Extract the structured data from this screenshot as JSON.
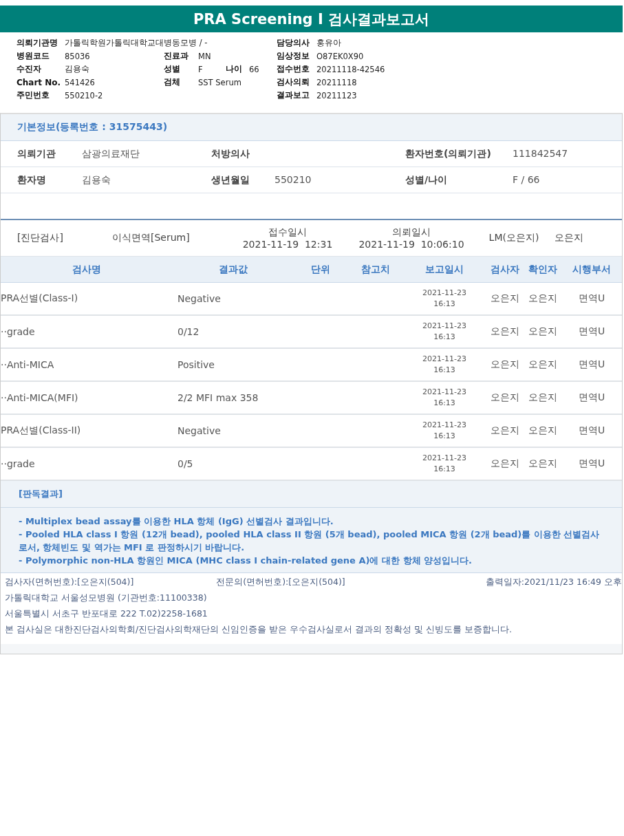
{
  "title": "PRA Screening I 검사결과보고서",
  "header_info": [
    {
      "left": {
        "label": "의뢰기관명",
        "value": "가톨릭학원가톨릭대학교대병동모병 / -"
      },
      "right": {
        "label": "담당의사",
        "value": "홍유아"
      }
    },
    {
      "left": {
        "label": "병원코드",
        "value": "85036"
      },
      "middle": [
        {
          "label": "진료과",
          "value": "MN"
        }
      ],
      "right": {
        "label": "임상정보",
        "value": "O87EK0X90"
      }
    },
    {
      "left": {
        "label": "수진자",
        "value": "김용숙"
      },
      "middle": [
        {
          "label": "성별",
          "value": "F"
        },
        {
          "label": "나이",
          "value": "66"
        }
      ],
      "right": {
        "label": "접수번호",
        "value": "20211118-42546"
      }
    },
    {
      "left": {
        "label": "Chart No.",
        "value": "541426"
      },
      "middle": [
        {
          "label": "검체",
          "value": "SST Serum"
        }
      ],
      "right": {
        "label": "검사의뢰",
        "value": "20211118"
      }
    },
    {
      "left": {
        "label": "주민번호",
        "value": "550210-2"
      },
      "right": {
        "label": "결과보고",
        "value": "20211123"
      }
    }
  ],
  "basic_info": {
    "title": "기본정보(등록번호 : 31575443)",
    "rows": [
      [
        {
          "label": "의뢰기관",
          "value": "삼광의료재단"
        },
        {
          "label": "처방의사"
        },
        {
          "label": "환자번호(의뢰기관)",
          "value": "111842547"
        }
      ],
      [
        {
          "label": "환자명",
          "value": "김용숙"
        },
        {
          "label": "생년월일",
          "value": "550210"
        },
        {
          "label": "성별/나이",
          "value": "F / 66"
        }
      ]
    ]
  },
  "exam": {
    "category": "[진단검사]",
    "specimen": "이식면역[Serum]",
    "received_label": "접수일시",
    "received": "2021-11-19  12:31",
    "requested_label": "의뢰일시",
    "requested": "2021-11-19  10:06:10",
    "lm": "LM(오은지)",
    "examiner": "오은지"
  },
  "table": {
    "columns": [
      "검사명",
      "결과값",
      "단위",
      "참고치",
      "보고일시",
      "검사자",
      "확인자",
      "시행부서"
    ],
    "rows": [
      {
        "name": "PRA선별(Class-I)",
        "result": "Negative",
        "date": "2021-11-23",
        "time": "16:13",
        "tester": "오은지",
        "confirmer": "오은지",
        "dept": "면역U"
      },
      {
        "name": "··grade",
        "result": "0/12",
        "date": "2021-11-23",
        "time": "16:13",
        "tester": "오은지",
        "confirmer": "오은지",
        "dept": "면역U"
      },
      {
        "name": "··Anti-MICA",
        "result": "Positive",
        "date": "2021-11-23",
        "time": "16:13",
        "tester": "오은지",
        "confirmer": "오은지",
        "dept": "면역U"
      },
      {
        "name": "··Anti-MICA(MFI)",
        "result": "2/2 MFI max 358",
        "date": "2021-11-23",
        "time": "16:13",
        "tester": "오은지",
        "confirmer": "오은지",
        "dept": "면역U"
      },
      {
        "name": "PRA선별(Class-II)",
        "result": "Negative",
        "date": "2021-11-23",
        "time": "16:13",
        "tester": "오은지",
        "confirmer": "오은지",
        "dept": "면역U"
      },
      {
        "name": "··grade",
        "result": "0/5",
        "date": "2021-11-23",
        "time": "16:13",
        "tester": "오은지",
        "confirmer": "오은지",
        "dept": "면역U"
      }
    ]
  },
  "interpretation": {
    "title": "[판독결과]",
    "lines": [
      "- Multiplex bead assay를 이용한 HLA 항체 (IgG) 선별검사 결과입니다.",
      "- Pooled HLA class I 항원 (12개 bead), pooled HLA class II 항원 (5개 bead), pooled MICA 항원 (2개 bead)를 이용한 선별검사로서, 항체빈도 및 역가는 MFI 로 판정하시기 바랍니다.",
      "- Polymorphic non-HLA 항원인 MICA (MHC class I chain-related gene A)에 대한 항체 양성입니다."
    ]
  },
  "footer": {
    "tester": "검사자(면허번호):[오은지(504)]",
    "specialist": "전문의(면허번호):[오은지(504)]",
    "printed": "출력일자:2021/11/23 16:49 오후",
    "lines": [
      "가톨릭대학교 서울성모병원 (기관번호:11100338)",
      "서울특별시 서초구 반포대로 222 T.02)2258-1681",
      "본 검사실은 대한진단검사의학회/진단검사의학재단의 신임인증을 받은 우수검사실로서 결과의 정확성 및 신빙도를 보증합니다."
    ]
  }
}
